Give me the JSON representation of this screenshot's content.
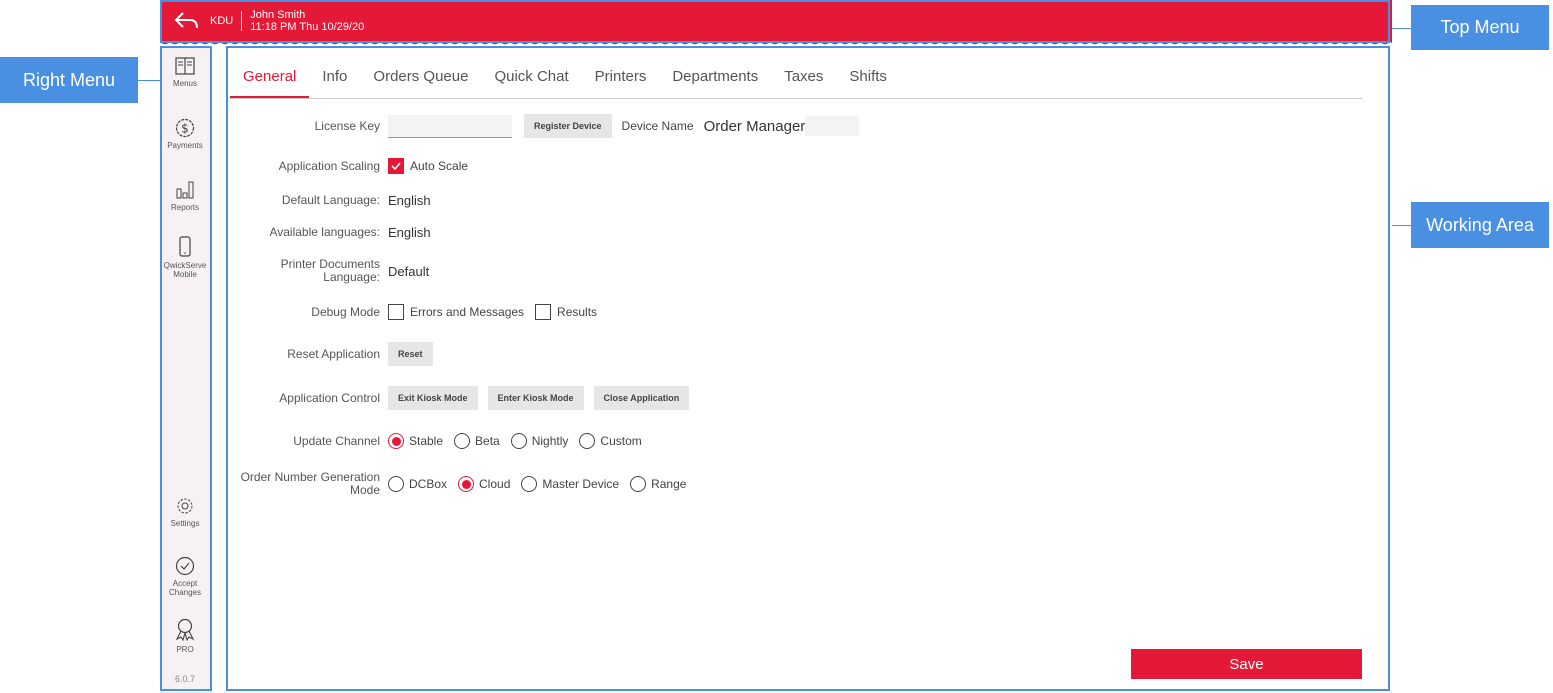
{
  "annotations": {
    "top_menu": "Top Menu",
    "right_menu": "Right Menu",
    "working_area": "Working Area"
  },
  "topbar": {
    "app_label": "KDU",
    "user_name": "John Smith",
    "datetime": "11:18 PM Thu 10/29/20"
  },
  "sidebar": {
    "items": [
      {
        "label": "Menus",
        "icon": "menu-book-icon"
      },
      {
        "label": "Payments",
        "icon": "dollar-icon"
      },
      {
        "label": "Reports",
        "icon": "bar-chart-icon"
      },
      {
        "label": "QwickServe Mobile",
        "icon": "phone-icon"
      },
      {
        "label": "Settings",
        "icon": "gear-icon"
      },
      {
        "label": "Accept Changes",
        "icon": "check-circle-icon"
      },
      {
        "label": "PRO",
        "icon": "badge-icon"
      }
    ],
    "version": "6.0.7"
  },
  "tabs": [
    "General",
    "Info",
    "Orders Queue",
    "Quick Chat",
    "Printers",
    "Departments",
    "Taxes",
    "Shifts"
  ],
  "form": {
    "license_key_label": "License Key",
    "register_button": "Register Device",
    "device_name_label": "Device Name",
    "device_name_value": "Order Manager",
    "app_scaling_label": "Application Scaling",
    "auto_scale": "Auto Scale",
    "default_language_label": "Default Language:",
    "default_language_value": "English",
    "available_languages_label": "Available languages:",
    "available_languages_value": "English",
    "printer_docs_label": "Printer Documents Language:",
    "printer_docs_value": "Default",
    "debug_mode_label": "Debug Mode",
    "debug_errors": "Errors and Messages",
    "debug_results": "Results",
    "reset_label": "Reset Application",
    "reset_button": "Reset",
    "app_control_label": "Application Control",
    "exit_kiosk": "Exit Kiosk Mode",
    "enter_kiosk": "Enter Kiosk Mode",
    "close_app": "Close Application",
    "update_channel_label": "Update Channel",
    "update_channel_options": [
      "Stable",
      "Beta",
      "Nightly",
      "Custom"
    ],
    "update_channel_selected": "Stable",
    "order_number_label": "Order Number Generation Mode",
    "order_number_options": [
      "DCBox",
      "Cloud",
      "Master Device",
      "Range"
    ],
    "order_number_selected": "Cloud"
  },
  "save_button": "Save",
  "colors": {
    "accent": "#e31937",
    "annotation": "#4a90e2"
  }
}
